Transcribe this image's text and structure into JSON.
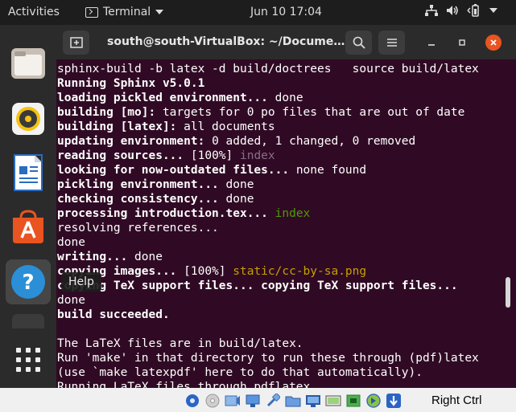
{
  "topbar": {
    "activities": "Activities",
    "app_name": "Terminal",
    "clock": "Jun 10  17:04"
  },
  "dock": {
    "tooltip": "Help",
    "items": [
      "files-icon",
      "rhythmbox-icon",
      "writer-icon",
      "software-icon",
      "help-icon",
      "terminal-icon",
      "show-apps-icon"
    ]
  },
  "window": {
    "title": "south@south-VirtualBox: ~/Docume…"
  },
  "terminal": {
    "lines": [
      [
        {
          "t": "sphinx-build -b latex -d build/doctrees   source build/latex"
        }
      ],
      [
        {
          "t": "Running Sphinx v5.0.1",
          "c": "b"
        }
      ],
      [
        {
          "t": "loading pickled environment... ",
          "c": "b"
        },
        {
          "t": "done"
        }
      ],
      [
        {
          "t": "building [mo]: ",
          "c": "b"
        },
        {
          "t": "targets for 0 po files that are out of date"
        }
      ],
      [
        {
          "t": "building [latex]: ",
          "c": "b"
        },
        {
          "t": "all documents"
        }
      ],
      [
        {
          "t": "updating environment: ",
          "c": "b"
        },
        {
          "t": "0 added, 1 changed, 0 removed"
        }
      ],
      [
        {
          "t": "reading sources... ",
          "c": "b"
        },
        {
          "t": "[100%] "
        },
        {
          "t": "index",
          "c": "dim"
        }
      ],
      [
        {
          "t": "looking for now-outdated files... ",
          "c": "b"
        },
        {
          "t": "none found"
        }
      ],
      [
        {
          "t": "pickling environment... ",
          "c": "b"
        },
        {
          "t": "done"
        }
      ],
      [
        {
          "t": "checking consistency... ",
          "c": "b"
        },
        {
          "t": "done"
        }
      ],
      [
        {
          "t": "processing introduction.tex... ",
          "c": "b"
        },
        {
          "t": "index",
          "c": "grn"
        }
      ],
      [
        {
          "t": "resolving references..."
        }
      ],
      [
        {
          "t": "done"
        }
      ],
      [
        {
          "t": "writing... ",
          "c": "b"
        },
        {
          "t": "done"
        }
      ],
      [
        {
          "t": "copying images... ",
          "c": "b"
        },
        {
          "t": "[100%] "
        },
        {
          "t": "static/cc-by-sa.png",
          "c": "ylw"
        }
      ],
      [
        {
          "t": "copying TeX support files... copying TeX support files...",
          "c": "b"
        }
      ],
      [
        {
          "t": "done"
        }
      ],
      [
        {
          "t": "build succeeded.",
          "c": "b"
        }
      ],
      [
        {
          "t": ""
        }
      ],
      [
        {
          "t": "The LaTeX files are in build/latex."
        }
      ],
      [
        {
          "t": "Run 'make' in that directory to run these through (pdf)latex"
        }
      ],
      [
        {
          "t": "(use `make latexpdf' here to do that automatically)."
        }
      ],
      [
        {
          "t": "Running LaTeX files through pdflatex..."
        }
      ]
    ]
  },
  "vbox": {
    "host_key": "Right Ctrl"
  }
}
